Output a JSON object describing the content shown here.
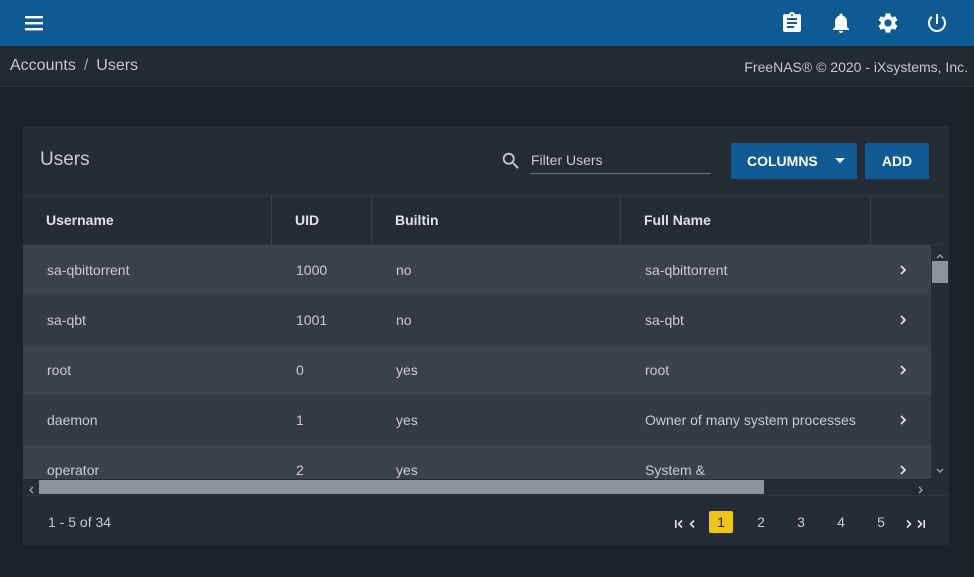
{
  "topbar": {
    "menu_icon": "hamburger-menu-icon",
    "icons": [
      "clipboard-icon",
      "bell-icon",
      "gear-icon",
      "power-icon"
    ],
    "accent": "#0e5b93"
  },
  "breadcrumb": {
    "items": [
      "Accounts",
      "Users"
    ],
    "separator": "/"
  },
  "copyright": "FreeNAS® © 2020 - iXsystems, Inc.",
  "card": {
    "title": "Users",
    "search": {
      "placeholder": "Filter Users",
      "value": ""
    },
    "columns_label": "COLUMNS",
    "add_label": "ADD"
  },
  "table": {
    "headers": [
      "Username",
      "UID",
      "Builtin",
      "Full Name"
    ],
    "rows": [
      {
        "username": "sa-qbittorrent",
        "uid": "1000",
        "builtin": "no",
        "full_name": "sa-qbittorrent"
      },
      {
        "username": "sa-qbt",
        "uid": "1001",
        "builtin": "no",
        "full_name": "sa-qbt"
      },
      {
        "username": "root",
        "uid": "0",
        "builtin": "yes",
        "full_name": "root"
      },
      {
        "username": "daemon",
        "uid": "1",
        "builtin": "yes",
        "full_name": "Owner of many system processes"
      },
      {
        "username": "operator",
        "uid": "2",
        "builtin": "yes",
        "full_name": "System &"
      }
    ]
  },
  "paginator": {
    "range_label": "1 - 5 of 34",
    "pages": [
      "1",
      "2",
      "3",
      "4",
      "5"
    ],
    "active_page": "1",
    "active_color": "#f0c419"
  }
}
